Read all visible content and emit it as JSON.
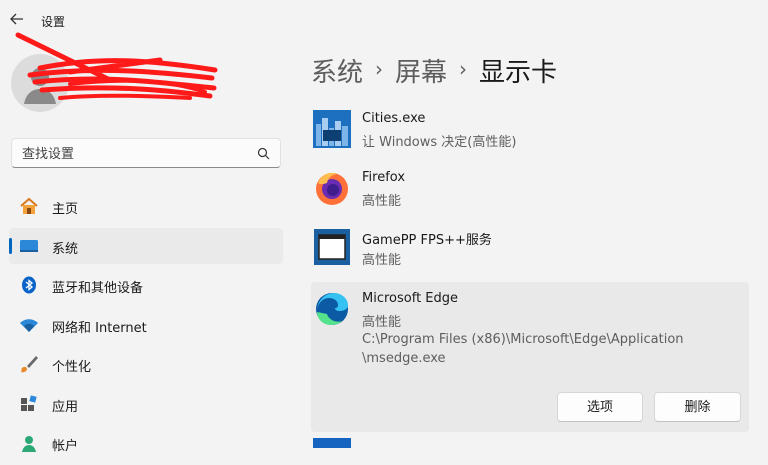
{
  "window": {
    "title": "设置"
  },
  "search": {
    "placeholder": "查找设置"
  },
  "sidebar": {
    "items": [
      {
        "label": "主页",
        "icon": "home-icon"
      },
      {
        "label": "系统",
        "icon": "system-icon",
        "active": true
      },
      {
        "label": "蓝牙和其他设备",
        "icon": "bluetooth-icon"
      },
      {
        "label": "网络和 Internet",
        "icon": "wifi-icon"
      },
      {
        "label": "个性化",
        "icon": "brush-icon"
      },
      {
        "label": "应用",
        "icon": "apps-icon"
      },
      {
        "label": "帐户",
        "icon": "account-icon"
      }
    ]
  },
  "breadcrumb": {
    "items": [
      "系统",
      "屏幕",
      "显示卡"
    ],
    "separator": "›"
  },
  "apps": [
    {
      "name": "Cities.exe",
      "preference": "让 Windows 决定(高性能)",
      "icon": "cities-skylines-icon"
    },
    {
      "name": "Firefox",
      "preference": "高性能",
      "icon": "firefox-icon"
    },
    {
      "name": "GamePP FPS++服务",
      "preference": "高性能",
      "icon": "window-app-icon"
    },
    {
      "name": "Microsoft Edge",
      "preference": "高性能",
      "path_line1": "C:\\Program Files (x86)\\Microsoft\\Edge\\Application",
      "path_line2": "\\msedge.exe",
      "icon": "edge-icon",
      "expanded": true
    }
  ],
  "buttons": {
    "options": "选项",
    "delete": "删除"
  },
  "colors": {
    "accent": "#0067c0",
    "background": "#f3f3f3",
    "redaction": "#ff1a1a"
  }
}
